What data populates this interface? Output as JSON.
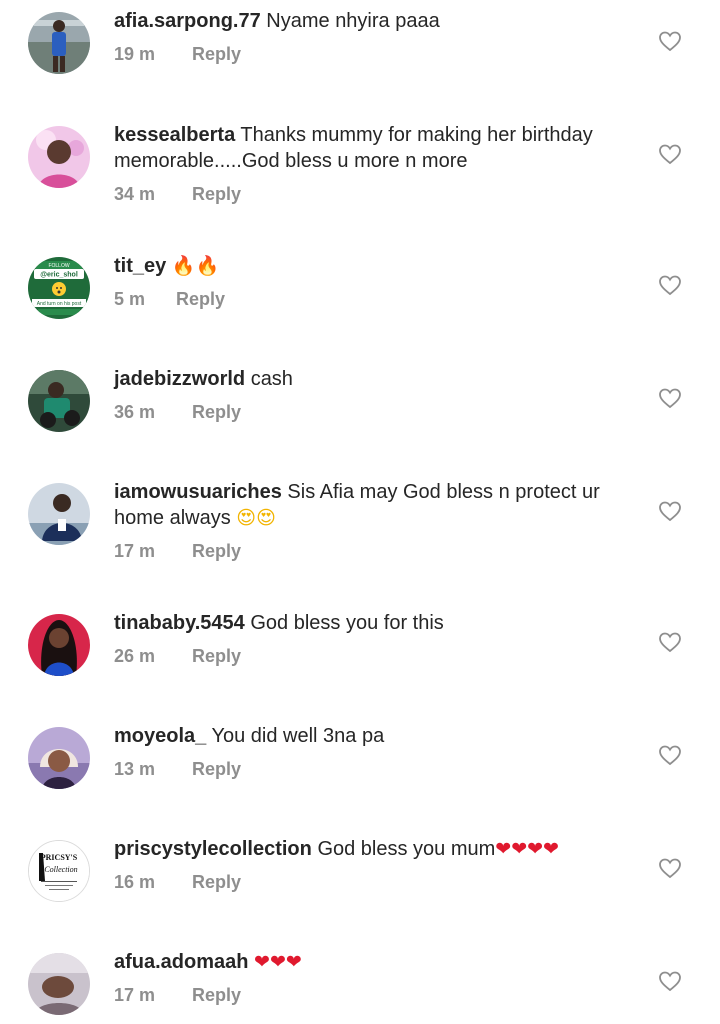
{
  "colors": {
    "text": "#262626",
    "meta": "#8e8e8e",
    "heart_outline": "#8e8e8e",
    "emoji_heart": "#e0192e",
    "emoji_fire": "#ff6a00"
  },
  "comments": [
    {
      "username": "afia.sarpong.77",
      "text": "Nyame nhyira paaa",
      "emoji": "",
      "time": "19 m",
      "reply": "Reply",
      "avatar_icon": "avatar-photo"
    },
    {
      "username": "kessealberta",
      "text": "Thanks mummy for making her birthday memorable.....God bless u more n more",
      "emoji": "",
      "time": "34 m",
      "reply": "Reply",
      "avatar_icon": "avatar-photo"
    },
    {
      "username": "tit_ey",
      "text": "",
      "emoji": "🔥🔥",
      "time": "5 m",
      "reply": "Reply",
      "avatar_icon": "avatar-follow-graphic"
    },
    {
      "username": "jadebizzworld",
      "text": "cash",
      "emoji": "",
      "time": "36 m",
      "reply": "Reply",
      "avatar_icon": "avatar-photo"
    },
    {
      "username": "iamowusuariches",
      "text": "Sis Afia may God bless n protect ur home always",
      "emoji": "😍😍",
      "time": "17 m",
      "reply": "Reply",
      "avatar_icon": "avatar-photo"
    },
    {
      "username": "tinababy.5454",
      "text": "God bless you for this",
      "emoji": "",
      "time": "26 m",
      "reply": "Reply",
      "avatar_icon": "avatar-photo"
    },
    {
      "username": "moyeola_",
      "text": "You did well 3na pa",
      "emoji": "",
      "time": "13 m",
      "reply": "Reply",
      "avatar_icon": "avatar-photo"
    },
    {
      "username": "priscystylecollection",
      "text": "God bless you mum",
      "emoji": "❤❤❤❤",
      "time": "16 m",
      "reply": "Reply",
      "avatar_icon": "avatar-logo"
    },
    {
      "username": "afua.adomaah",
      "text": "",
      "emoji": "❤❤❤",
      "time": "17 m",
      "reply": "Reply",
      "avatar_icon": "avatar-photo"
    }
  ],
  "avatar_badges": {
    "tit_ey": {
      "line1": "FOLLOW",
      "handle": "@eric_shol",
      "line3": "And turn on his post"
    },
    "priscystylecollection": {
      "line1": "PRICSY'S",
      "line2": "Collection"
    }
  }
}
